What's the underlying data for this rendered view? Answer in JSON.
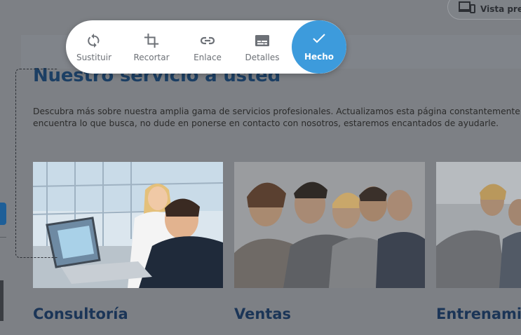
{
  "page": {
    "heading": "Nuestro servicio a usted",
    "intro": "Descubra más sobre nuestra amplia gama de servicios profesionales. Actualizamos esta página constantemente. Si no encuentra lo que busca, no dude en ponerse en contacto con nosotros, estaremos encantados de ayudarle.",
    "services": [
      {
        "title": "Consultoría"
      },
      {
        "title": "Ventas"
      },
      {
        "title": "Entrenamiento"
      }
    ]
  },
  "toolbar": {
    "replace_label": "Sustituir",
    "replace_icon": "refresh-icon",
    "crop_label": "Recortar",
    "crop_icon": "crop-icon",
    "link_label": "Enlace",
    "link_icon": "link-icon",
    "details_label": "Detalles",
    "details_icon": "subtitles-icon",
    "done_label": "Hecho",
    "done_icon": "check-icon"
  },
  "header": {
    "preview_label": "Vista previa",
    "preview_icon": "devices-icon"
  },
  "colors": {
    "accent": "#3d9bdc",
    "heading": "#1c3f64",
    "overlay": "#7d8085"
  }
}
